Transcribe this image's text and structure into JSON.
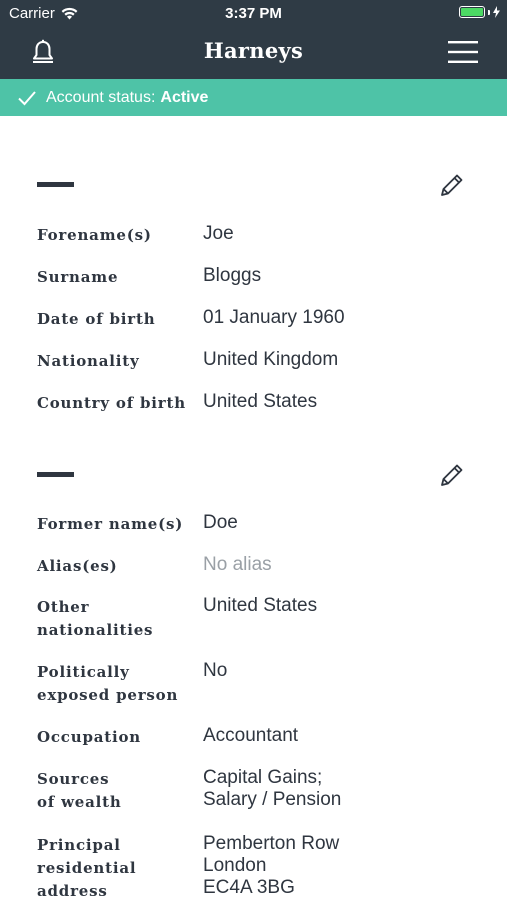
{
  "status_bar": {
    "carrier": "Carrier",
    "time": "3:37 PM",
    "wifi_icon": "wifi-icon",
    "battery_icon": "battery-icon"
  },
  "navbar": {
    "title": "Harneys",
    "left_icon": "bell-icon",
    "right_icon": "hamburger-menu-icon"
  },
  "banner": {
    "label": "Account status:",
    "status": "Active",
    "icon": "checkmark-icon",
    "color": "#4ec3a7"
  },
  "colors": {
    "header_bg": "#2f3b45",
    "text": "#2f3640",
    "muted": "#9aa0a6"
  },
  "sections": [
    {
      "edit_icon": "pencil-icon",
      "rows": [
        {
          "label": "Forename(s)",
          "value": "Joe"
        },
        {
          "label": "Surname",
          "value": "Bloggs"
        },
        {
          "label": "Date of birth",
          "value": "01 January 1960"
        },
        {
          "label": "Nationality",
          "value": "United Kingdom"
        },
        {
          "label": "Country of birth",
          "value": "United States"
        }
      ]
    },
    {
      "edit_icon": "pencil-icon",
      "rows": [
        {
          "label": "Former name(s)",
          "value": "Doe"
        },
        {
          "label": "Alias(es)",
          "value": "No alias",
          "muted": true
        },
        {
          "label": "Other\nnationalities",
          "value": "United States"
        },
        {
          "label": "Politically\nexposed person",
          "value": "No"
        },
        {
          "label": "Occupation",
          "value": "Accountant"
        },
        {
          "label": "Sources\nof wealth",
          "value": "Capital Gains;\nSalary / Pension"
        },
        {
          "label": "Principal\nresidential\naddress",
          "value": "Pemberton Row\nLondon\nEC4A 3BG"
        }
      ]
    }
  ]
}
